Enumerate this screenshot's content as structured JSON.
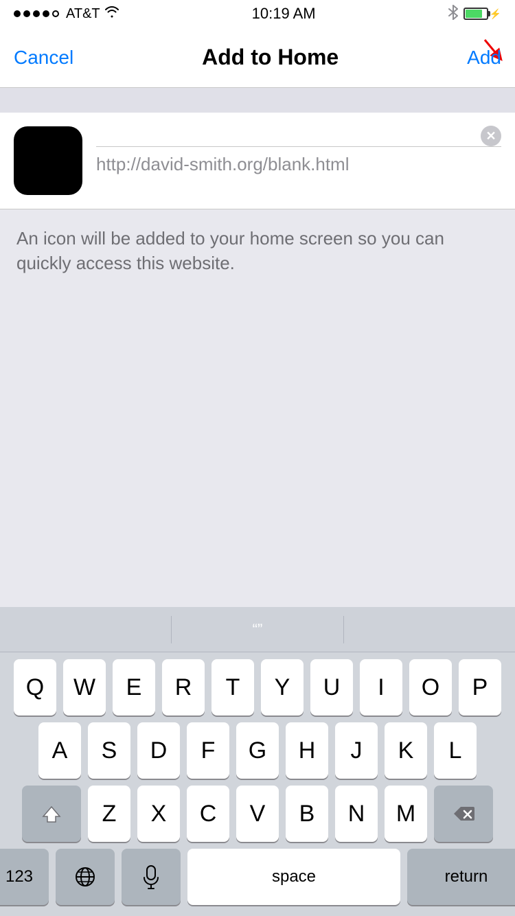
{
  "statusBar": {
    "carrier": "AT&T",
    "time": "10:19 AM",
    "signalDots": [
      true,
      true,
      true,
      true,
      false
    ],
    "batteryPercent": 80
  },
  "navBar": {
    "cancelLabel": "Cancel",
    "title": "Add to Home",
    "addLabel": "Add"
  },
  "urlRow": {
    "url": "http://david-smith.org/blank.html"
  },
  "description": {
    "text": "An icon will be added to your home screen so you can quickly access this website."
  },
  "keyboard": {
    "suggestionsLabel": "“”",
    "rows": [
      [
        "Q",
        "W",
        "E",
        "R",
        "T",
        "Y",
        "U",
        "I",
        "O",
        "P"
      ],
      [
        "A",
        "S",
        "D",
        "F",
        "G",
        "H",
        "J",
        "K",
        "L"
      ],
      [
        "Z",
        "X",
        "C",
        "V",
        "B",
        "N",
        "M"
      ]
    ],
    "spaceLabel": "space",
    "returnLabel": "return",
    "numLabel": "123"
  }
}
